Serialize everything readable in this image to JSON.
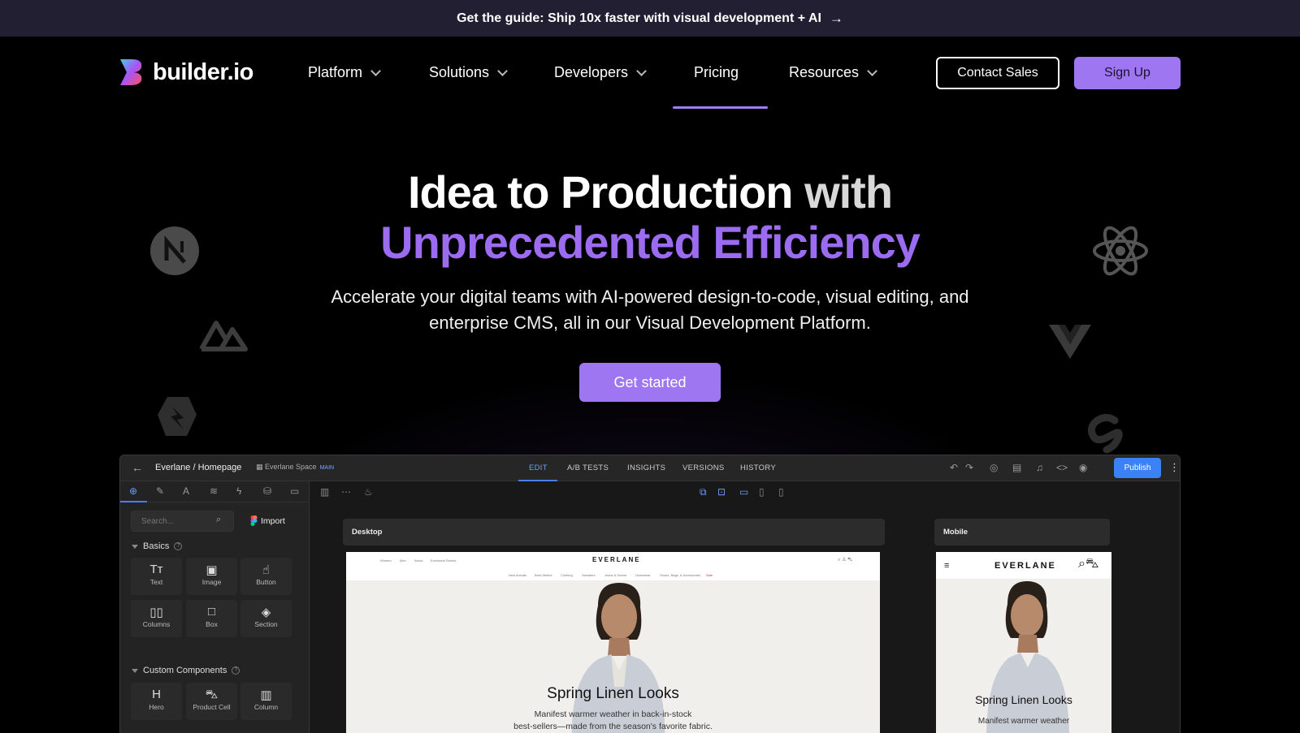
{
  "announcement": {
    "text": "Get the guide: Ship 10x faster with visual development + AI",
    "arrow_icon": "arrow-right-icon"
  },
  "nav": {
    "logo_text": "builder.io",
    "items": [
      {
        "label": "Platform",
        "has_dropdown": true
      },
      {
        "label": "Solutions",
        "has_dropdown": true
      },
      {
        "label": "Developers",
        "has_dropdown": true
      },
      {
        "label": "Pricing",
        "has_dropdown": false,
        "active": true
      },
      {
        "label": "Resources",
        "has_dropdown": true
      }
    ],
    "contact_label": "Contact Sales",
    "signup_label": "Sign Up"
  },
  "hero": {
    "title_line1_main": "Idea to Production",
    "title_line1_muted": "with",
    "title_line2": "Unprecedented Efficiency",
    "subtitle": "Accelerate your digital teams with AI-powered design-to-code, visual editing, and enterprise CMS, all in our Visual Development Platform.",
    "cta_label": "Get started",
    "framework_icons": [
      "nextjs-icon",
      "nuxt-icon",
      "qwik-icon",
      "react-icon",
      "vue-icon",
      "svelte-icon"
    ]
  },
  "editor": {
    "breadcrumb": "Everlane / Homepage",
    "space_label": "Everlane Space",
    "space_tag": "MAIN",
    "tabs": [
      "EDIT",
      "A/B TESTS",
      "INSIGHTS",
      "VERSIONS",
      "HISTORY"
    ],
    "active_tab": "EDIT",
    "publish_label": "Publish",
    "search_placeholder": "Search...",
    "import_label": "Import",
    "basics_title": "Basics",
    "basics_blocks": [
      "Text",
      "Image",
      "Button",
      "Columns",
      "Box",
      "Section"
    ],
    "custom_title": "Custom Components",
    "custom_blocks": [
      "Hero",
      "Product Cell",
      "Column"
    ],
    "desktop_label": "Desktop",
    "mobile_label": "Mobile",
    "site": {
      "brand": "EVERLANE",
      "top_links": [
        "Women",
        "Men",
        "About",
        "Everworld Stories"
      ],
      "category_links": [
        "New Arrivals",
        "Best-Sellers",
        "Clothing",
        "Sweaters",
        "Jeans & Denim",
        "Outerwear",
        "Shoes, Bags, & Accessories",
        "Sale"
      ],
      "hero_title": "Spring Linen Looks",
      "hero_text_line1": "Manifest warmer weather in back-in-stock",
      "hero_text_line2": "best-sellers—made from the season's favorite fabric.",
      "mobile_text": "Manifest warmer weather"
    }
  },
  "colors": {
    "accent": "#9f76f2",
    "announcement_bg": "#231f33",
    "publish_blue": "#3b82f6"
  }
}
